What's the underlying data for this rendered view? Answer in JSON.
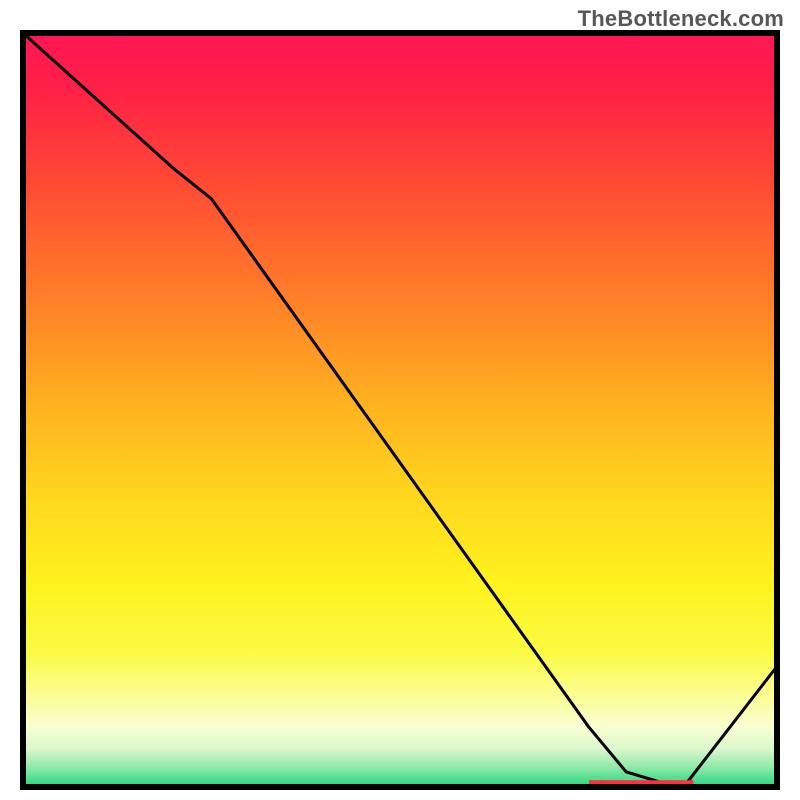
{
  "watermark": "TheBottleneck.com",
  "colors": {
    "border": "#000000",
    "line": "#000000",
    "marker": "#ff2f3f",
    "gradient_stops": [
      {
        "offset": 0.0,
        "color": "#ff1554"
      },
      {
        "offset": 0.08,
        "color": "#ff2246"
      },
      {
        "offset": 0.2,
        "color": "#ff4a33"
      },
      {
        "offset": 0.35,
        "color": "#ff7e28"
      },
      {
        "offset": 0.5,
        "color": "#ffb41f"
      },
      {
        "offset": 0.62,
        "color": "#ffd81e"
      },
      {
        "offset": 0.73,
        "color": "#fff21e"
      },
      {
        "offset": 0.82,
        "color": "#fbfb42"
      },
      {
        "offset": 0.88,
        "color": "#fbfd95"
      },
      {
        "offset": 0.92,
        "color": "#fafed0"
      },
      {
        "offset": 0.95,
        "color": "#d9f7cd"
      },
      {
        "offset": 0.975,
        "color": "#8be8a6"
      },
      {
        "offset": 1.0,
        "color": "#22d77e"
      }
    ]
  },
  "chart_data": {
    "type": "line",
    "title": "",
    "xlabel": "",
    "ylabel": "",
    "xlim": [
      0,
      100
    ],
    "ylim": [
      0,
      100
    ],
    "x": [
      0,
      10,
      20,
      25,
      30,
      40,
      50,
      60,
      70,
      75,
      80,
      85,
      88,
      100
    ],
    "values": [
      100,
      91,
      82,
      78,
      71,
      57,
      43,
      29,
      15,
      8,
      2,
      0.5,
      0.5,
      16
    ],
    "flat_markers_x": [
      76,
      77.5,
      79,
      80.5,
      82,
      83.5,
      85,
      86.5,
      88
    ],
    "flat_markers_y": [
      0.5,
      0.5,
      0.5,
      0.5,
      0.5,
      0.5,
      0.5,
      0.5,
      0.5
    ]
  }
}
